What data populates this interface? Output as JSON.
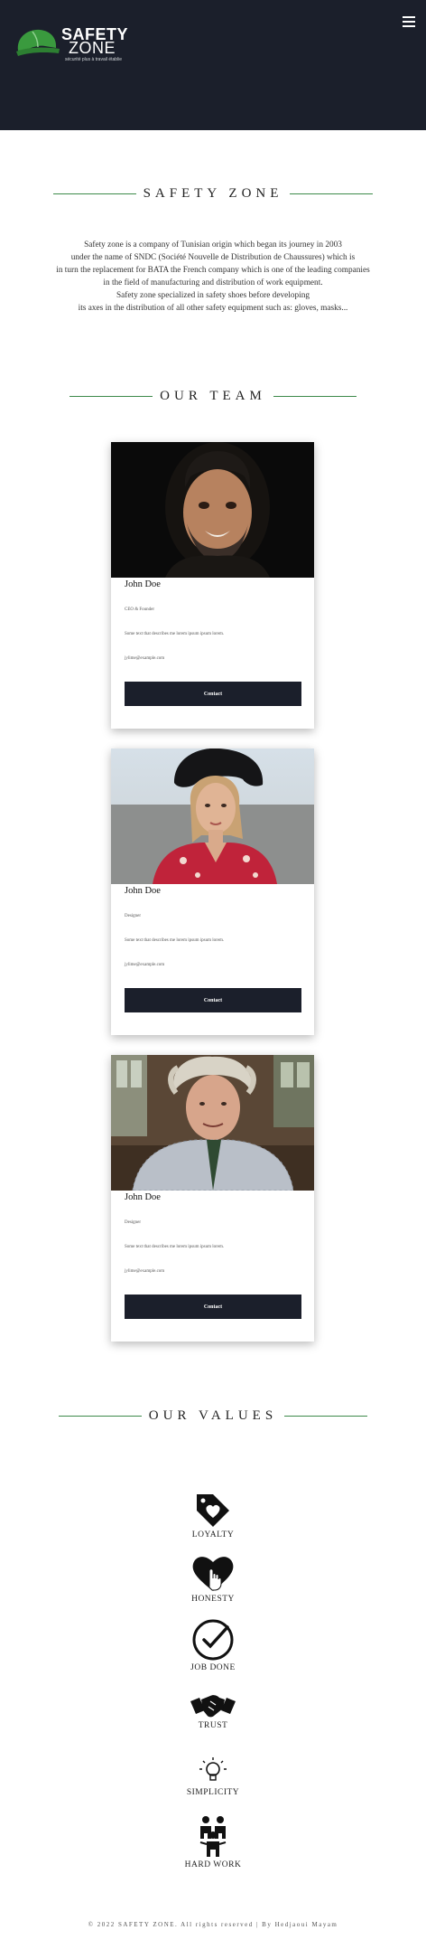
{
  "header": {
    "brand_line1": "SAFETY",
    "brand_line2": "ZONE",
    "brand_tagline": "sécurité plus à travail établie"
  },
  "about": {
    "title": "SAFETY ZONE",
    "lines": [
      "Safety zone is a company of Tunisian origin which began its journey in 2003",
      "under the name of SNDC (Société Nouvelle de Distribution de Chaussures) which is",
      "in turn the replacement for BATA the French company which is one of the leading companies",
      "in the field of manufacturing and distribution of work equipment.",
      "Safety zone specialized in safety shoes before developing",
      "its axes in the distribution of all other safety equipment such as: gloves, masks..."
    ]
  },
  "team": {
    "title": "OUR TEAM",
    "members": [
      {
        "name": "John Doe",
        "role": "CEO & Founder",
        "desc": "Some text that describes me lorem ipsum ipsum lorem.",
        "email": "jylime@example.com",
        "button": "Contact"
      },
      {
        "name": "John Doe",
        "role": "Designer",
        "desc": "Some text that describes me lorem ipsum ipsum lorem.",
        "email": "jylime@example.com",
        "button": "Contact"
      },
      {
        "name": "John Doe",
        "role": "Designer",
        "desc": "Some text that describes me lorem ipsum ipsum lorem.",
        "email": "jylime@example.com",
        "button": "Contact"
      }
    ]
  },
  "values": {
    "title": "OUR VALUES",
    "items": [
      {
        "label": "LOYALTY",
        "icon": "tag-heart-icon"
      },
      {
        "label": "HONESTY",
        "icon": "heart-hand-icon"
      },
      {
        "label": "JOB DONE",
        "icon": "check-circle-icon"
      },
      {
        "label": "TRUST",
        "icon": "handshake-icon"
      },
      {
        "label": "SIMPLICITY",
        "icon": "lightbulb-icon"
      },
      {
        "label": "HARD WORK",
        "icon": "teamwork-icon"
      }
    ]
  },
  "footer": {
    "text": "© 2022 SAFETY ZONE. All rights reserved | By Hedjaoui Mayam"
  }
}
